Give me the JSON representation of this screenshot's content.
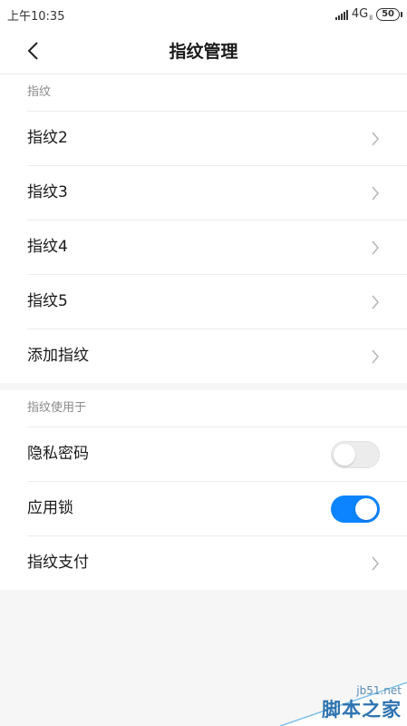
{
  "status_bar": {
    "time": "上午10:35",
    "network": "4G",
    "network_sub": "ll",
    "battery": "50"
  },
  "header": {
    "title": "指纹管理"
  },
  "fingerprints_section": {
    "title": "指纹",
    "items": [
      {
        "label": "指纹2"
      },
      {
        "label": "指纹3"
      },
      {
        "label": "指纹4"
      },
      {
        "label": "指纹5"
      },
      {
        "label": "添加指纹"
      }
    ]
  },
  "usage_section": {
    "title": "指纹使用于",
    "items": [
      {
        "label": "隐私密码",
        "type": "toggle",
        "enabled": false
      },
      {
        "label": "应用锁",
        "type": "toggle",
        "enabled": true
      },
      {
        "label": "指纹支付",
        "type": "link"
      }
    ]
  },
  "watermark": {
    "site": "jb51.net",
    "name": "脚本之家"
  },
  "colors": {
    "accent": "#0d84ff",
    "background": "#f6f6f6",
    "divider": "#ececec"
  }
}
